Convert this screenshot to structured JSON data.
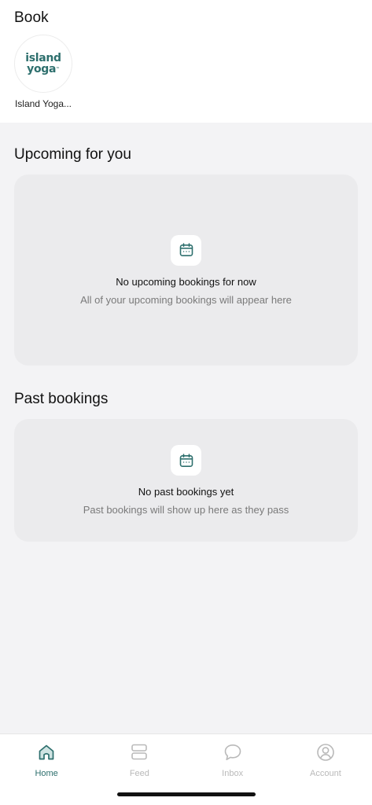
{
  "header": {
    "title": "Book",
    "studio": {
      "logo_line1": "island",
      "logo_line2": "yoga",
      "logo_tm": "™",
      "name": "Island Yoga..."
    }
  },
  "upcoming": {
    "heading": "Upcoming for you",
    "empty_title": "No upcoming bookings for now",
    "empty_subtitle": "All of your upcoming bookings will appear here"
  },
  "past": {
    "heading": "Past bookings",
    "empty_title": "No past bookings yet",
    "empty_subtitle": "Past bookings will show up here as they pass"
  },
  "tabs": [
    {
      "label": "Home",
      "icon": "home-icon",
      "active": true
    },
    {
      "label": "Feed",
      "icon": "feed-icon",
      "active": false
    },
    {
      "label": "Inbox",
      "icon": "inbox-icon",
      "active": false
    },
    {
      "label": "Account",
      "icon": "account-icon",
      "active": false
    }
  ],
  "colors": {
    "accent": "#2d6f6d",
    "background": "#f3f3f5",
    "card": "#ebebed",
    "inactive_tab": "#b9b9b9"
  }
}
